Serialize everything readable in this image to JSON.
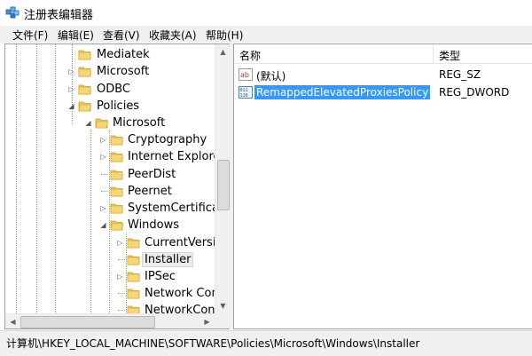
{
  "window": {
    "title": "注册表编辑器"
  },
  "menu": {
    "items": [
      {
        "label": "文件(F)"
      },
      {
        "label": "编辑(E)"
      },
      {
        "label": "查看(V)"
      },
      {
        "label": "收藏夹(A)"
      },
      {
        "label": "帮助(H)"
      }
    ]
  },
  "tree": {
    "nodes": [
      {
        "label": "Mediatek",
        "expander": ""
      },
      {
        "label": "Microsoft",
        "expander": "▷"
      },
      {
        "label": "ODBC",
        "expander": "▷"
      },
      {
        "label": "Policies",
        "expander": "◢"
      },
      {
        "label": "Microsoft",
        "expander": "◢"
      },
      {
        "label": "Cryptography",
        "expander": "▷"
      },
      {
        "label": "Internet Explorer",
        "expander": "▷"
      },
      {
        "label": "PeerDist",
        "expander": ""
      },
      {
        "label": "Peernet",
        "expander": ""
      },
      {
        "label": "SystemCertificates",
        "expander": "▷"
      },
      {
        "label": "Windows",
        "expander": "◢"
      },
      {
        "label": "CurrentVersion",
        "expander": "▷"
      },
      {
        "label": "Installer",
        "expander": "",
        "selected": true
      },
      {
        "label": "IPSec",
        "expander": "▷"
      },
      {
        "label": "Network Connections",
        "expander": ""
      },
      {
        "label": "NetworkConnectivityStatusIndicator",
        "expander": ""
      }
    ]
  },
  "list": {
    "columns": {
      "name": "名称",
      "type": "类型"
    },
    "rows": [
      {
        "icon": "string-value-icon",
        "name": "(默认)",
        "type": "REG_SZ",
        "selected": false
      },
      {
        "icon": "dword-value-icon",
        "name": "RemappedElevatedProxiesPolicy",
        "type": "REG_DWORD",
        "selected": true
      }
    ]
  },
  "status": {
    "path": "计算机\\HKEY_LOCAL_MACHINE\\SOFTWARE\\Policies\\Microsoft\\Windows\\Installer"
  },
  "colors": {
    "selection": "#3399ff",
    "folder": "#f2c94c"
  }
}
